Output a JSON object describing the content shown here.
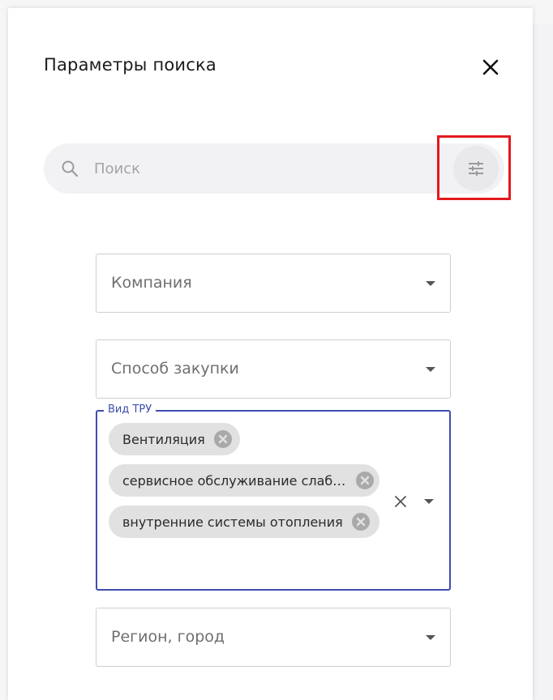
{
  "panel": {
    "title": "Параметры поиска"
  },
  "search": {
    "placeholder": "Поиск",
    "value": ""
  },
  "filters": {
    "company": {
      "label": "Компания"
    },
    "procurement_method": {
      "label": "Способ закупки"
    },
    "product_type": {
      "legend": "Вид ТРУ",
      "chips": [
        {
          "label": "Вентиляция"
        },
        {
          "label": "сервисное обслуживание слаботочных систем"
        },
        {
          "label": "внутренние системы отопления"
        }
      ]
    },
    "region": {
      "label": "Регион, город"
    }
  },
  "colors": {
    "accent": "#3f4dad",
    "highlight": "#e31a1c",
    "chip_bg": "#e1e1e1"
  },
  "icons": {
    "close": "close-icon",
    "search": "search-icon",
    "filter": "tune-sliders-icon",
    "chip_remove": "remove-circle-icon",
    "dropdown": "caret-down-icon"
  }
}
